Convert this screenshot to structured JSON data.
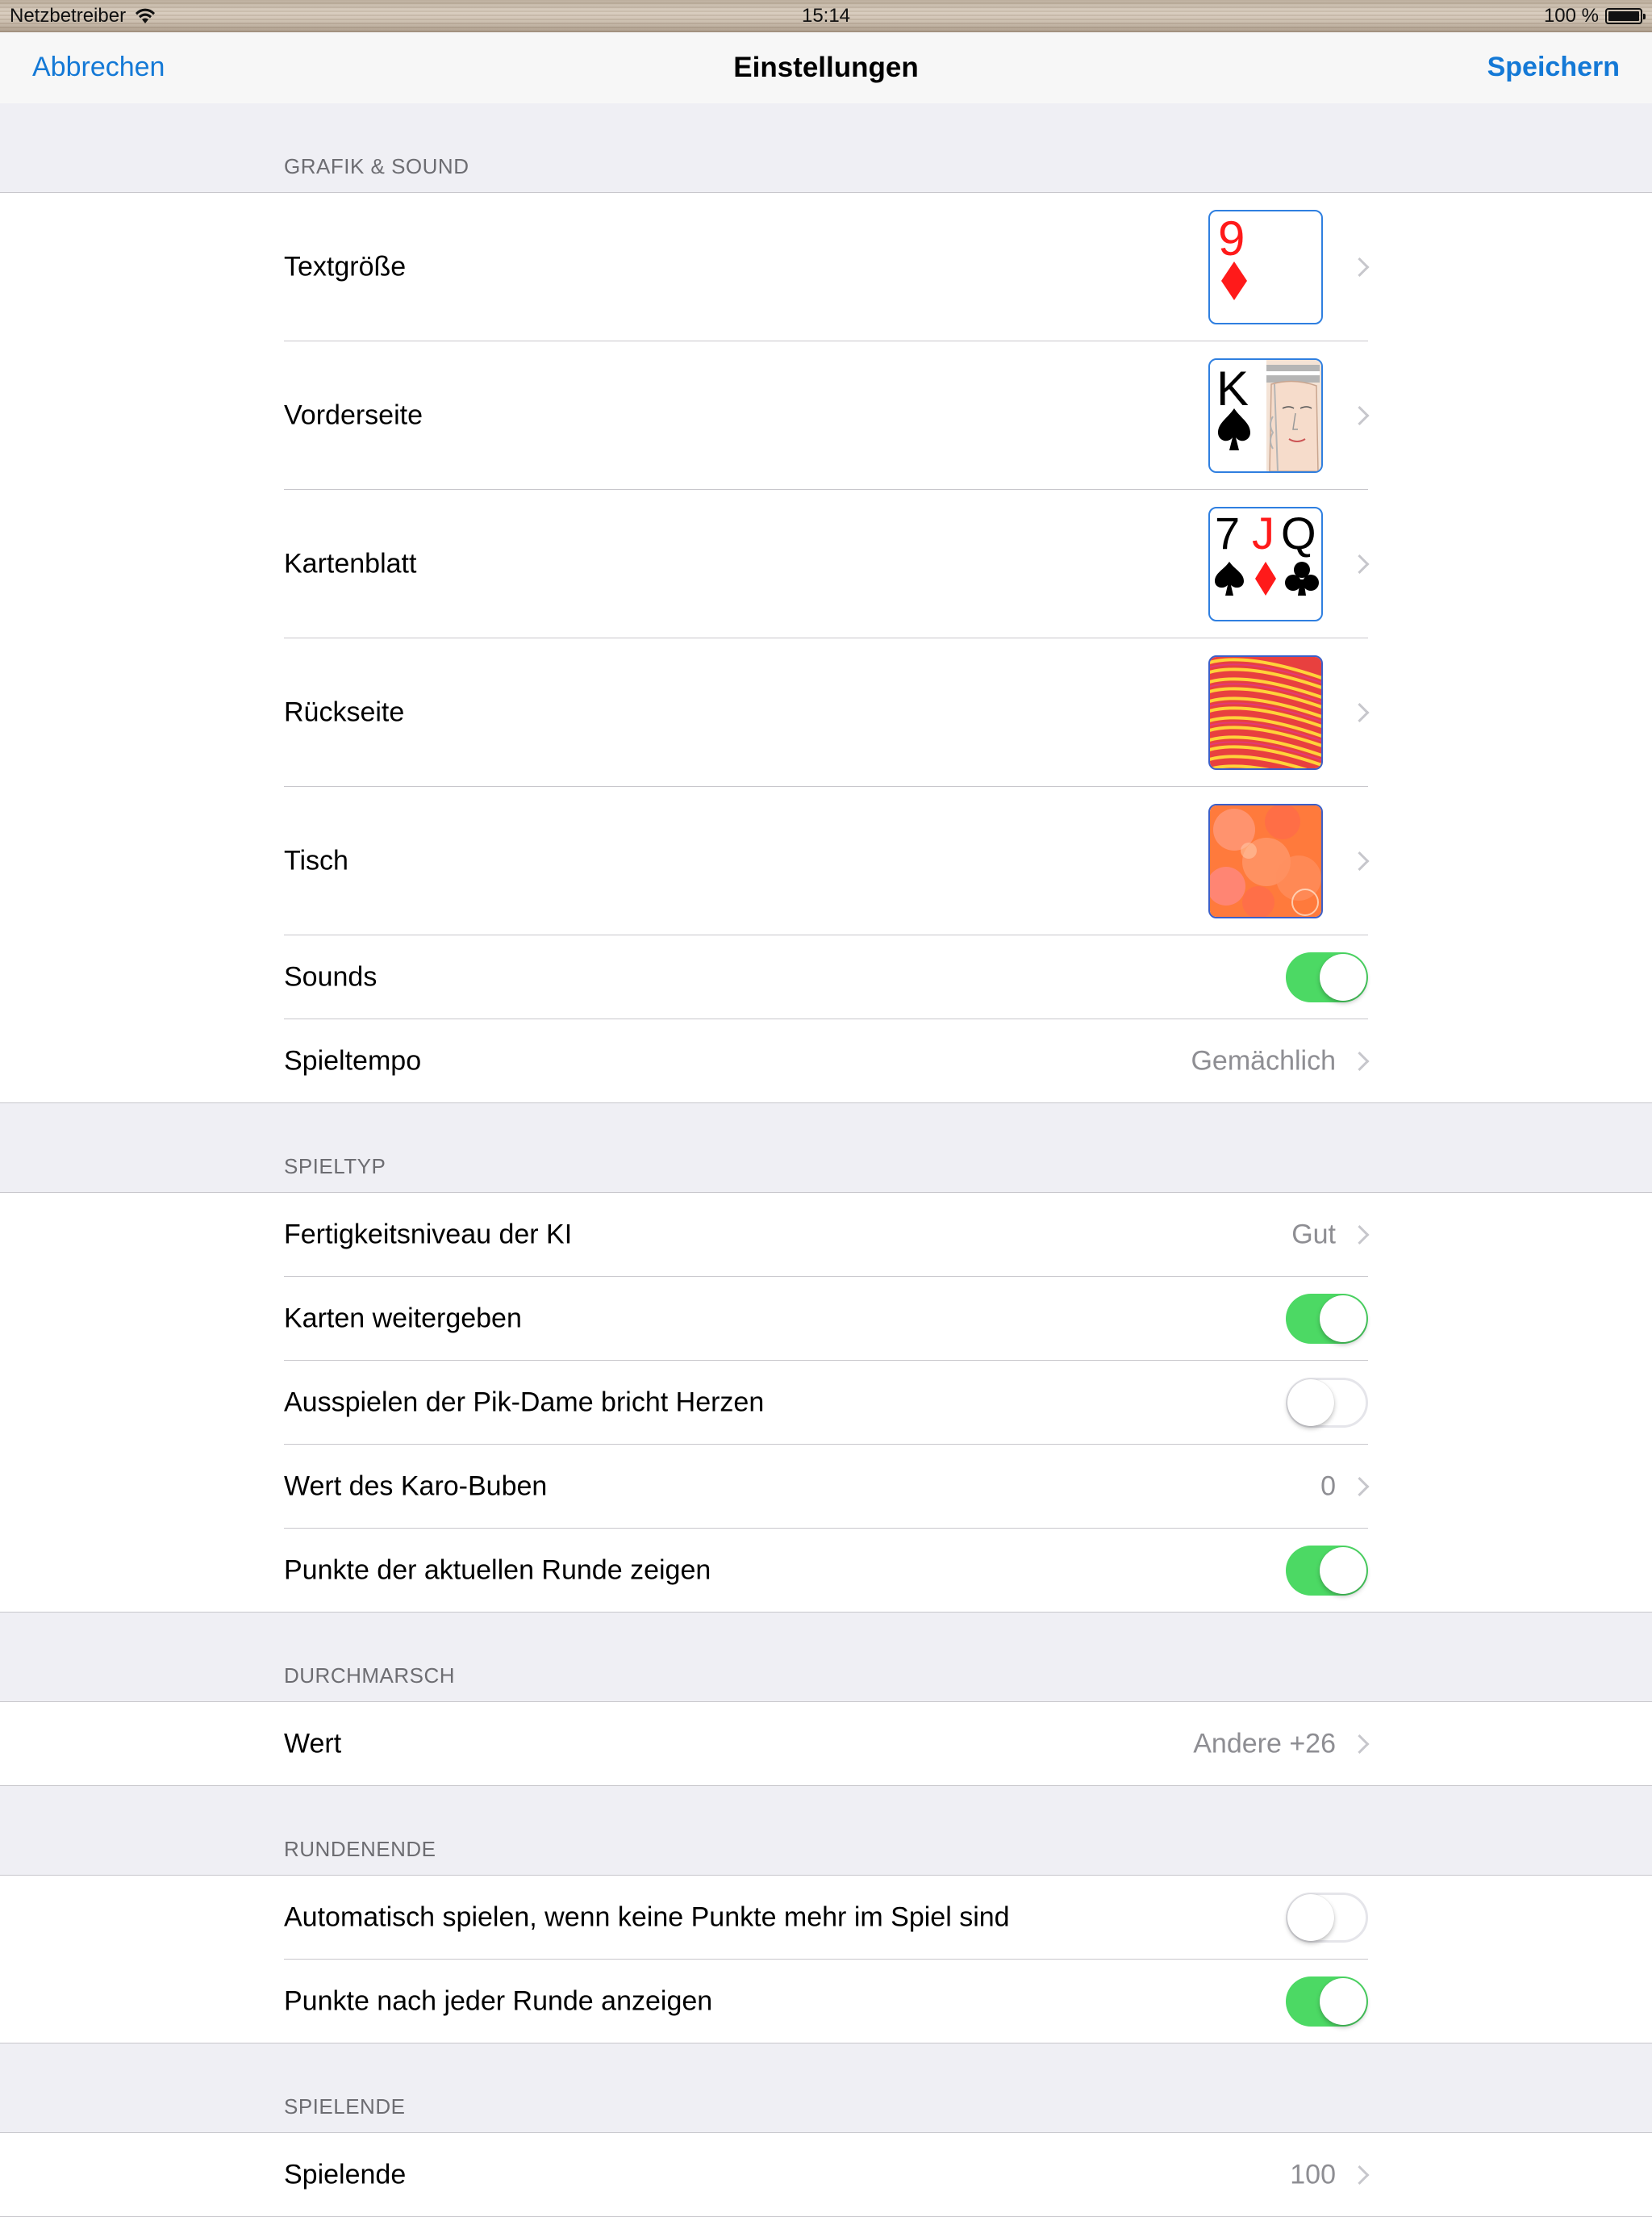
{
  "status_bar": {
    "carrier": "Netzbetreiber",
    "time": "15:14",
    "battery": "100 %",
    "battery_level": 1.0
  },
  "nav": {
    "cancel": "Abbrechen",
    "title": "Einstellungen",
    "save": "Speichern"
  },
  "sections": {
    "grafik": {
      "header": "GRAFIK & SOUND",
      "rows": {
        "textgroesse": {
          "label": "Textgröße",
          "card_rank": "9"
        },
        "vorderseite": {
          "label": "Vorderseite",
          "card_rank": "K"
        },
        "kartenblatt": {
          "label": "Kartenblatt",
          "ranks": [
            "7",
            "J",
            "Q"
          ]
        },
        "rueckseite": {
          "label": "Rückseite"
        },
        "tisch": {
          "label": "Tisch"
        },
        "sounds": {
          "label": "Sounds",
          "on": true
        },
        "spieltempo": {
          "label": "Spieltempo",
          "value": "Gemächlich"
        }
      }
    },
    "spieltyp": {
      "header": "SPIELTYP",
      "rows": {
        "ki": {
          "label": "Fertigkeitsniveau der KI",
          "value": "Gut"
        },
        "weitergeben": {
          "label": "Karten weitergeben",
          "on": true
        },
        "pikdame": {
          "label": "Ausspielen der Pik-Dame bricht Herzen",
          "on": false
        },
        "karobube": {
          "label": "Wert des Karo-Buben",
          "value": "0"
        },
        "punkte_runde": {
          "label": "Punkte der aktuellen Runde zeigen",
          "on": true
        }
      }
    },
    "durchmarsch": {
      "header": "DURCHMARSCH",
      "rows": {
        "wert": {
          "label": "Wert",
          "value": "Andere +26"
        }
      }
    },
    "rundenende": {
      "header": "RUNDENENDE",
      "rows": {
        "automatisch": {
          "label": "Automatisch spielen, wenn keine Punkte mehr im Spiel sind",
          "on": false
        },
        "punkte_anzeigen": {
          "label": "Punkte nach jeder Runde anzeigen",
          "on": true
        }
      }
    },
    "spielende": {
      "header": "SPIELENDE",
      "rows": {
        "spielende": {
          "label": "Spielende",
          "value": "100"
        }
      }
    }
  },
  "colors": {
    "accent": "#1479d6",
    "toggle_on": "#4cd964",
    "card_border": "#2f7fe0",
    "red_suit": "#ff1a1a"
  }
}
